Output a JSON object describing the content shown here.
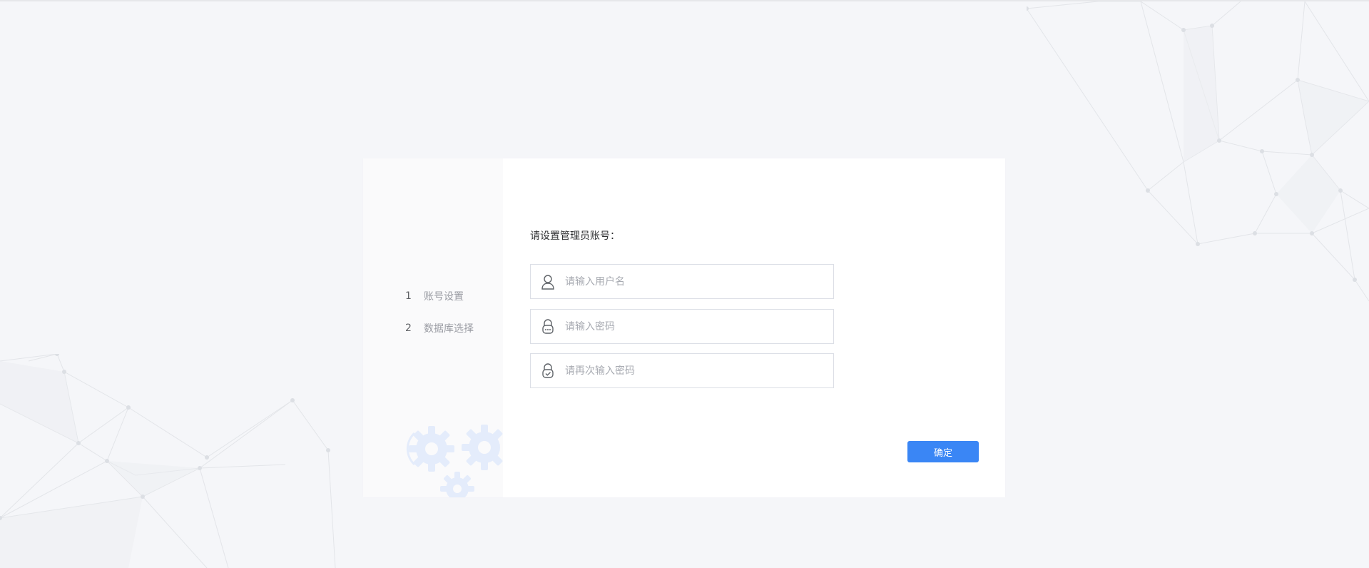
{
  "steps": [
    {
      "number": "1",
      "label": "账号设置"
    },
    {
      "number": "2",
      "label": "数据库选择"
    }
  ],
  "form": {
    "title": "请设置管理员账号：",
    "username": {
      "placeholder": "请输入用户名",
      "icon": "user-icon"
    },
    "password": {
      "placeholder": "请输入密码",
      "icon": "lock-icon"
    },
    "confirm_password": {
      "placeholder": "请再次输入密码",
      "icon": "lock-check-icon"
    },
    "confirm_label": "确定"
  },
  "colors": {
    "accent": "#3a86f5",
    "background": "#f5f6f9"
  }
}
